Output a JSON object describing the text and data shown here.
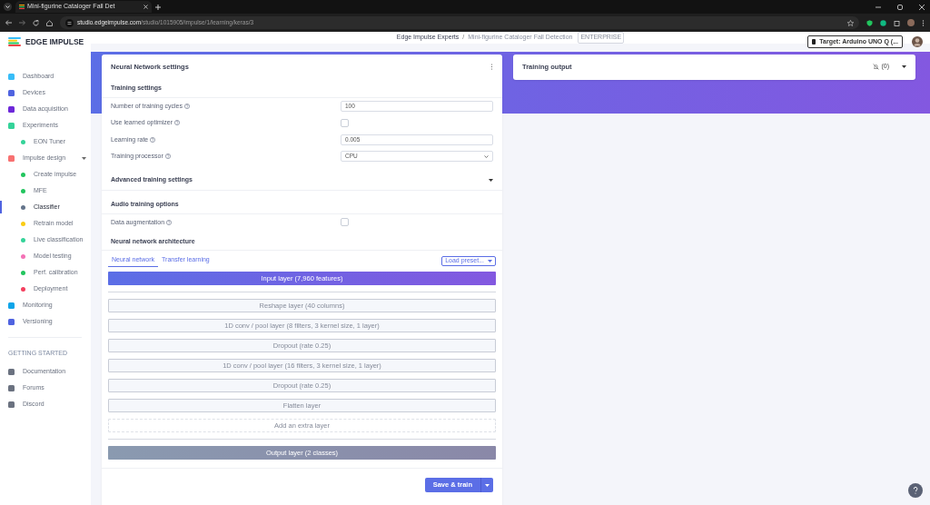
{
  "browser": {
    "tab_title": "Mini-figurine Cataloger Fall Det",
    "url_host": "studio.edgeimpulse.com",
    "url_path": "/studio/1015905/impulse/1/learning/keras/3"
  },
  "header": {
    "logo_text": "EDGE IMPULSE",
    "breadcrumb": [
      {
        "text": "Edge Impulse Experts",
        "kind": "org"
      },
      {
        "text": "/",
        "kind": "sep"
      },
      {
        "text": "Mini-figurine Cataloger Fall Detection",
        "kind": "project"
      }
    ],
    "badge": "ENTERPRISE",
    "target": "Target: Arduino UNO Q (..."
  },
  "sidebar": {
    "items": [
      {
        "label": "Dashboard",
        "color": "#38bdf8",
        "selected": false
      },
      {
        "label": "Devices",
        "color": "#4f63e0",
        "selected": false
      },
      {
        "label": "Data acquisition",
        "color": "#6d28d9",
        "selected": false
      },
      {
        "label": "Experiments",
        "color": "#34d399",
        "selected": false,
        "children": [
          {
            "label": "EON Tuner",
            "color": "#34d399",
            "selected": false
          }
        ]
      },
      {
        "label": "Impulse design",
        "color": "#f87171",
        "selected": false,
        "expanded": true,
        "children": [
          {
            "label": "Create impulse",
            "color": "#22c55e",
            "selected": false
          },
          {
            "label": "MFE",
            "color": "#22c55e",
            "selected": false
          },
          {
            "label": "Classifier",
            "color": "#64748b",
            "selected": true
          },
          {
            "label": "Retrain model",
            "color": "#facc15",
            "selected": false
          },
          {
            "label": "Live classification",
            "color": "#34d399",
            "selected": false
          },
          {
            "label": "Model testing",
            "color": "#f472b6",
            "selected": false
          },
          {
            "label": "Perf. calibration",
            "color": "#22c55e",
            "selected": false
          },
          {
            "label": "Deployment",
            "color": "#f43f5e",
            "selected": false
          }
        ]
      },
      {
        "label": "Monitoring",
        "color": "#0ea5e9",
        "selected": false
      },
      {
        "label": "Versioning",
        "color": "#4f63e0",
        "selected": false
      }
    ],
    "section_title": "GETTING STARTED",
    "help_items": [
      {
        "label": "Documentation",
        "color": "#6b7280"
      },
      {
        "label": "Forums",
        "color": "#6b7280"
      },
      {
        "label": "Discord",
        "color": "#6b7280"
      }
    ]
  },
  "settings_card": {
    "title": "Neural Network settings",
    "training": {
      "title": "Training settings",
      "fields": [
        {
          "label": "Number of training cycles",
          "kind": "text",
          "value": "100"
        },
        {
          "label": "Use learned optimizer",
          "kind": "checkbox",
          "checked": false
        },
        {
          "label": "Learning rate",
          "kind": "text",
          "value": "0.005"
        },
        {
          "label": "Training processor",
          "kind": "select",
          "value": "CPU"
        }
      ]
    },
    "advanced": {
      "title": "Advanced training settings",
      "expanded": false
    },
    "audio": {
      "title": "Audio training options",
      "fields": [
        {
          "label": "Data augmentation",
          "kind": "checkbox",
          "checked": false
        }
      ]
    },
    "architecture": {
      "title": "Neural network architecture",
      "tabs": [
        {
          "label": "Neural network",
          "selected": true
        },
        {
          "label": "Transfer learning",
          "selected": false
        }
      ],
      "preset_button": "Load preset...",
      "layers": [
        {
          "label": "Input layer (7,960 features)",
          "kind": "input"
        },
        {
          "label": "Reshape layer (40 columns)",
          "kind": "layer"
        },
        {
          "label": "1D conv / pool layer (8 filters, 3 kernel size, 1 layer)",
          "kind": "layer"
        },
        {
          "label": "Dropout (rate 0.25)",
          "kind": "layer"
        },
        {
          "label": "1D conv / pool layer (16 filters, 3 kernel size, 1 layer)",
          "kind": "layer"
        },
        {
          "label": "Dropout (rate 0.25)",
          "kind": "layer"
        },
        {
          "label": "Flatten layer",
          "kind": "layer"
        },
        {
          "label": "Add an extra layer",
          "kind": "add"
        },
        {
          "label": "Output layer (2 classes)",
          "kind": "output"
        }
      ]
    },
    "save_button": "Save & train"
  },
  "output_card": {
    "title": "Training output",
    "count": "(0)"
  }
}
